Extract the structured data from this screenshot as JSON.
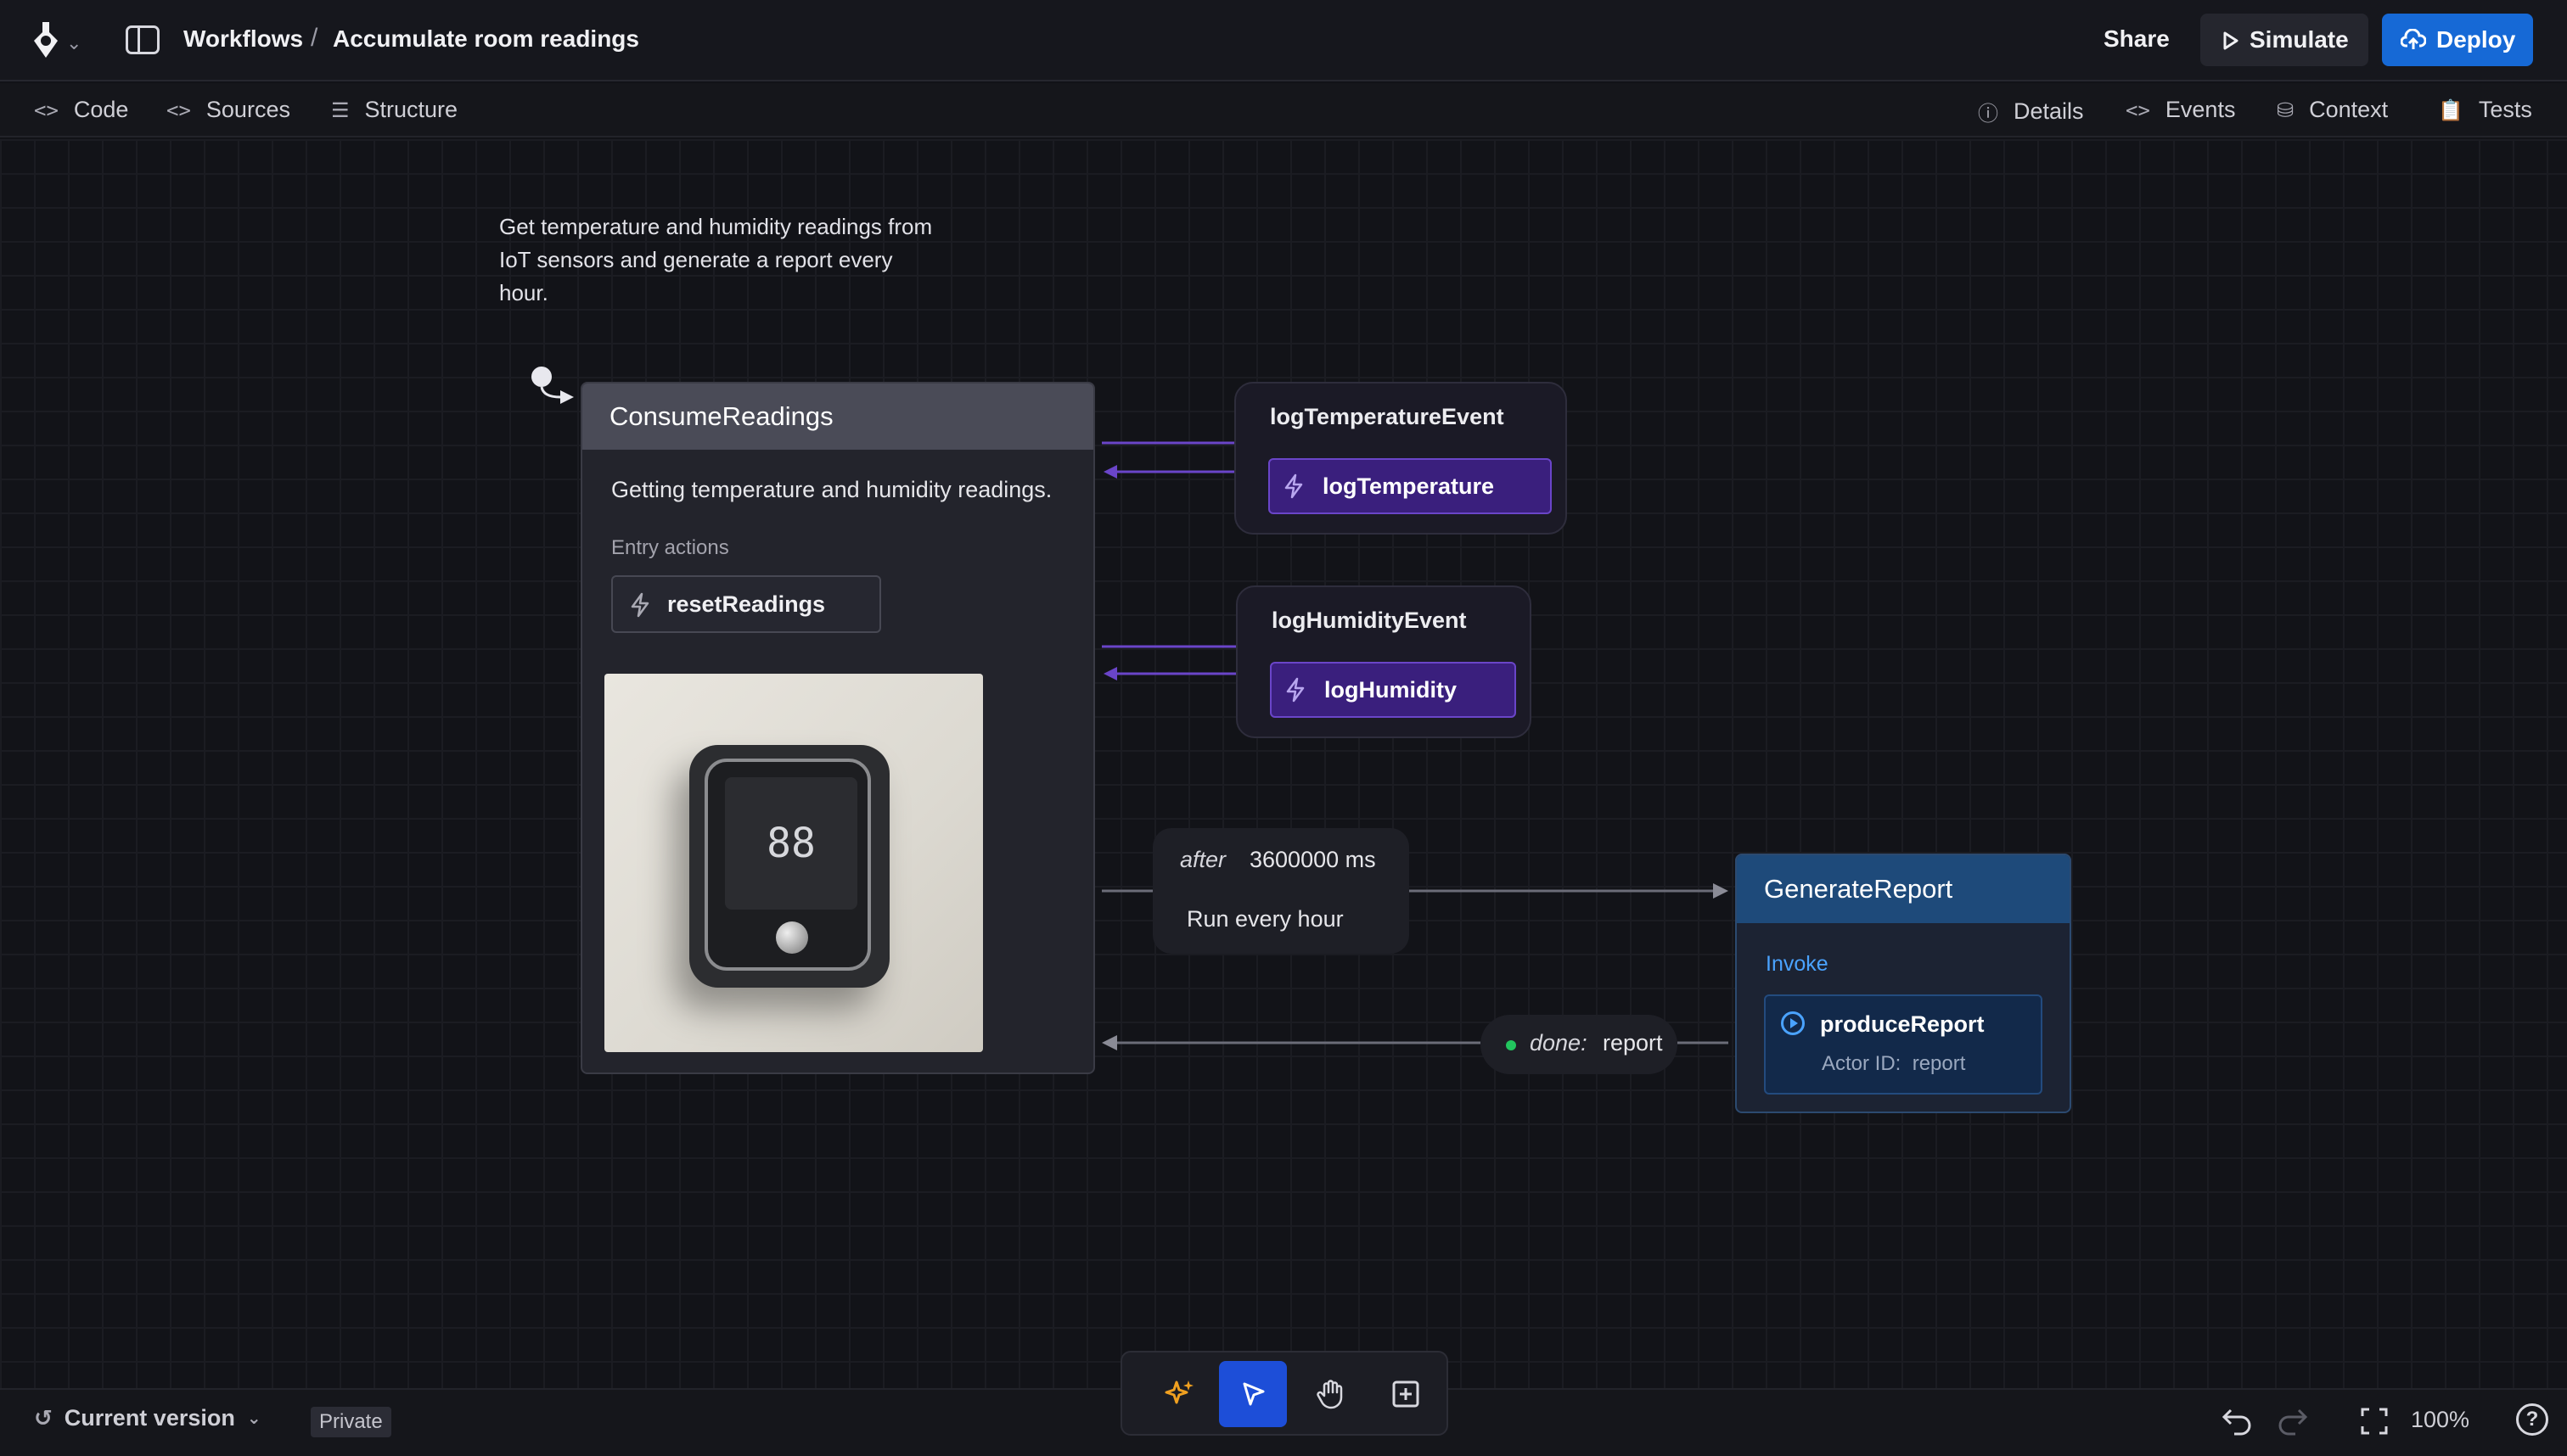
{
  "header": {
    "breadcrumb_root": "Workflows",
    "breadcrumb_separator": "/",
    "title": "Accumulate room readings",
    "share_label": "Share",
    "simulate_label": "Simulate",
    "deploy_label": "Deploy"
  },
  "tabs_left": [
    {
      "icon": "code-icon",
      "label": "Code"
    },
    {
      "icon": "code-icon",
      "label": "Sources"
    },
    {
      "icon": "structure-icon",
      "label": "Structure"
    }
  ],
  "tabs_right": [
    {
      "icon": "info-icon",
      "label": "Details"
    },
    {
      "icon": "code-icon",
      "label": "Events"
    },
    {
      "icon": "database-icon",
      "label": "Context"
    },
    {
      "icon": "clipboard-icon",
      "label": "Tests"
    }
  ],
  "canvas": {
    "description": "Get temperature and humidity readings from IoT sensors and generate a report every hour.",
    "consume_state": {
      "name": "ConsumeReadings",
      "description": "Getting temperature and humidity readings.",
      "entry_label": "Entry actions",
      "entry_action": "resetReadings",
      "thermostat_display": "88"
    },
    "events": [
      {
        "name": "logTemperatureEvent",
        "action": "logTemperature"
      },
      {
        "name": "logHumidityEvent",
        "action": "logHumidity"
      }
    ],
    "after_transition": {
      "keyword": "after",
      "value": "3600000 ms",
      "label": "Run every hour"
    },
    "done_transition": {
      "keyword": "done:",
      "value": "report"
    },
    "generate_state": {
      "name": "GenerateReport",
      "invoke_label": "Invoke",
      "actor_name": "produceReport",
      "actor_id_label": "Actor ID:",
      "actor_id": "report"
    },
    "colors": {
      "event_accent": "#6a45c9",
      "state_accent": "#1e4a7a",
      "done_dot": "#22c55e"
    }
  },
  "footer": {
    "version_label": "Current version",
    "visibility": "Private",
    "zoom": "100%",
    "help": "?"
  },
  "toolbar": {
    "tools": [
      "sparkle-icon",
      "pointer-icon",
      "hand-icon",
      "add-box-icon"
    ],
    "active_tool": "pointer-icon"
  }
}
